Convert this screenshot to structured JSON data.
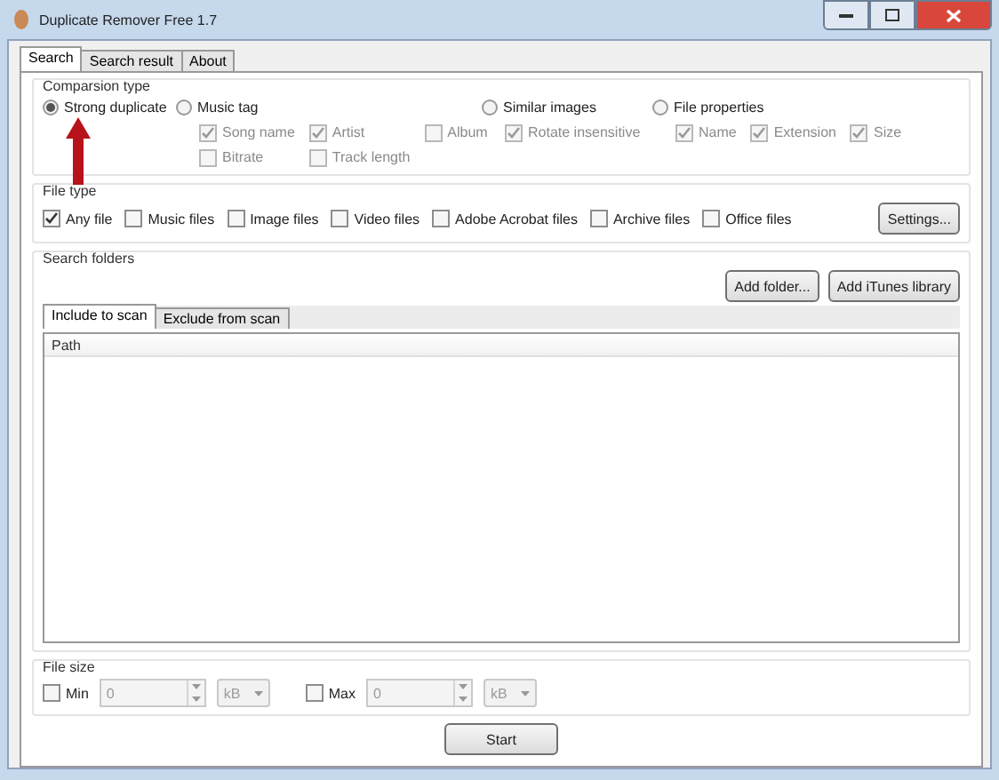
{
  "window": {
    "title": "Duplicate Remover Free 1.7"
  },
  "tabs": [
    {
      "label": "Search",
      "selected": true
    },
    {
      "label": "Search result",
      "selected": false
    },
    {
      "label": "About",
      "selected": false
    }
  ],
  "comparison_type": {
    "title": "Comparsion type",
    "options": [
      {
        "label": "Strong duplicate",
        "selected": true
      },
      {
        "label": "Music tag",
        "selected": false,
        "checkboxes": [
          {
            "label": "Song name",
            "checked": true
          },
          {
            "label": "Artist",
            "checked": true
          },
          {
            "label": "Album",
            "checked": false
          },
          {
            "label": "Bitrate",
            "checked": false
          },
          {
            "label": "Track length",
            "checked": false
          }
        ]
      },
      {
        "label": "Similar images",
        "selected": false,
        "checkboxes": [
          {
            "label": "Rotate insensitive",
            "checked": true
          }
        ]
      },
      {
        "label": "File properties",
        "selected": false,
        "checkboxes": [
          {
            "label": "Name",
            "checked": true
          },
          {
            "label": "Extension",
            "checked": true
          },
          {
            "label": "Size",
            "checked": true
          }
        ]
      }
    ]
  },
  "file_type": {
    "title": "File type",
    "options": [
      {
        "label": "Any file",
        "checked": true
      },
      {
        "label": "Music files",
        "checked": false
      },
      {
        "label": "Image files",
        "checked": false
      },
      {
        "label": "Video files",
        "checked": false
      },
      {
        "label": "Adobe Acrobat files",
        "checked": false
      },
      {
        "label": "Archive files",
        "checked": false
      },
      {
        "label": "Office files",
        "checked": false
      }
    ],
    "button": "Settings..."
  },
  "search_folders": {
    "title": "Search folders",
    "buttons": [
      "Add folder...",
      "Add iTunes library"
    ],
    "tabs": [
      {
        "label": "Include to scan",
        "selected": true
      },
      {
        "label": "Exclude from scan",
        "selected": false
      }
    ],
    "columns": [
      "Path"
    ]
  },
  "file_size": {
    "title": "File size",
    "limits": [
      {
        "label": "Min",
        "checked": false,
        "value": "0",
        "unit": "kB",
        "disabled": true
      },
      {
        "label": "Max",
        "checked": false,
        "value": "0",
        "unit": "kB",
        "disabled": true
      }
    ]
  },
  "start_button": "Start"
}
